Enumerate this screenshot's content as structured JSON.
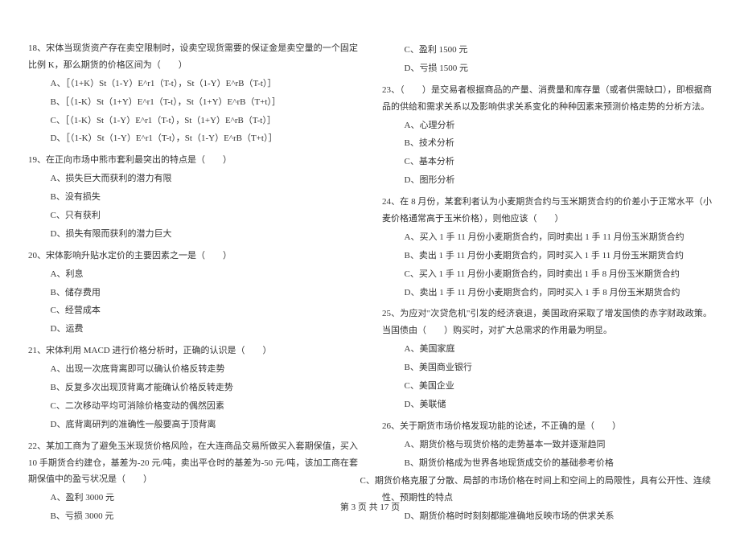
{
  "left_column": {
    "q18": {
      "text": "18、宋体当现货资产存在卖空限制时，设卖空现货需要的保证金是卖空量的一个固定比例 K，那么期货的价格区间为（　　）",
      "options": [
        "A、［（1+K）St（1-Y）E^r1（T-t），St（1-Y）E^rB（T-t）］",
        "B、［（1-K）St（1+Y）E^r1（T-t），St（1+Y）E^rB（T+t）］",
        "C、［（1-K）St（1-Y）E^r1（T-t），St（1+Y）E^rB（T-t）］",
        "D、［（1-K）St（1-Y）E^r1（T-t），St（1-Y）E^rB（T+t）］"
      ]
    },
    "q19": {
      "text": "19、在正向市场中熊市套利最突出的特点是（　　）",
      "options": [
        "A、损失巨大而获利的潜力有限",
        "B、没有损失",
        "C、只有获利",
        "D、损失有限而获利的潜力巨大"
      ]
    },
    "q20": {
      "text": "20、宋体影响升贴水定价的主要因素之一是（　　）",
      "options": [
        "A、利息",
        "B、储存费用",
        "C、经营成本",
        "D、运费"
      ]
    },
    "q21": {
      "text": "21、宋体利用 MACD 进行价格分析时，正确的认识是（　　）",
      "options": [
        "A、出现一次底背离即可以确认价格反转走势",
        "B、反复多次出现顶背离才能确认价格反转走势",
        "C、二次移动平均可消除价格变动的偶然因素",
        "D、底背离研判的准确性一般要高于顶背离"
      ]
    },
    "q22": {
      "text": "22、某加工商为了避免玉米现货价格风险，在大连商品交易所做买入套期保值，买入 10 手期货合约建仓，基差为-20 元/吨，卖出平仓时的基差为-50 元/吨，该加工商在套期保值中的盈亏状况是（　　）",
      "options": [
        "A、盈利 3000 元",
        "B、亏损 3000 元"
      ]
    }
  },
  "right_column": {
    "q22_cont": {
      "options": [
        "C、盈利 1500 元",
        "D、亏损 1500 元"
      ]
    },
    "q23": {
      "text": "23、（　　）是交易者根据商品的产量、消费量和库存量（或者供需缺口），即根据商品的供给和需求关系以及影响供求关系变化的种种因素来预测价格走势的分析方法。",
      "options": [
        "A、心理分析",
        "B、技术分析",
        "C、基本分析",
        "D、图形分析"
      ]
    },
    "q24": {
      "text": "24、在 8 月份，某套利者认为小麦期货合约与玉米期货合约的价差小于正常水平（小麦价格通常高于玉米价格），则他应该（　　）",
      "options": [
        "A、买入 1 手 11 月份小麦期货合约，同时卖出 1 手 11 月份玉米期货合约",
        "B、卖出 1 手 11 月份小麦期货合约，同时买入 1 手 11 月份玉米期货合约",
        "C、买入 1 手 11 月份小麦期货合约，同时卖出 1 手 8 月份玉米期货合约",
        "D、卖出 1 手 11 月份小麦期货合约，同时买入 1 手 8 月份玉米期货合约"
      ]
    },
    "q25": {
      "text": "25、为应对\"次贷危机\"引发的经济衰退，美国政府采取了增发国债的赤字财政政策。当国债由（　　）购买时，对扩大总需求的作用最为明显。",
      "options": [
        "A、美国家庭",
        "B、美国商业银行",
        "C、美国企业",
        "D、美联储"
      ]
    },
    "q26": {
      "text": "26、关于期货市场价格发现功能的论述，不正确的是（　　）",
      "options": [
        "A、期货价格与现货价格的走势基本一致并逐渐趋同",
        "B、期货价格成为世界各地现货成交价的基础参考价格",
        "C、期货价格克服了分散、局部的市场价格在时间上和空间上的局限性，具有公开性、连续性、预期性的特点",
        "D、期货价格时时刻刻都能准确地反映市场的供求关系"
      ]
    }
  },
  "footer": "第 3 页  共 17 页"
}
